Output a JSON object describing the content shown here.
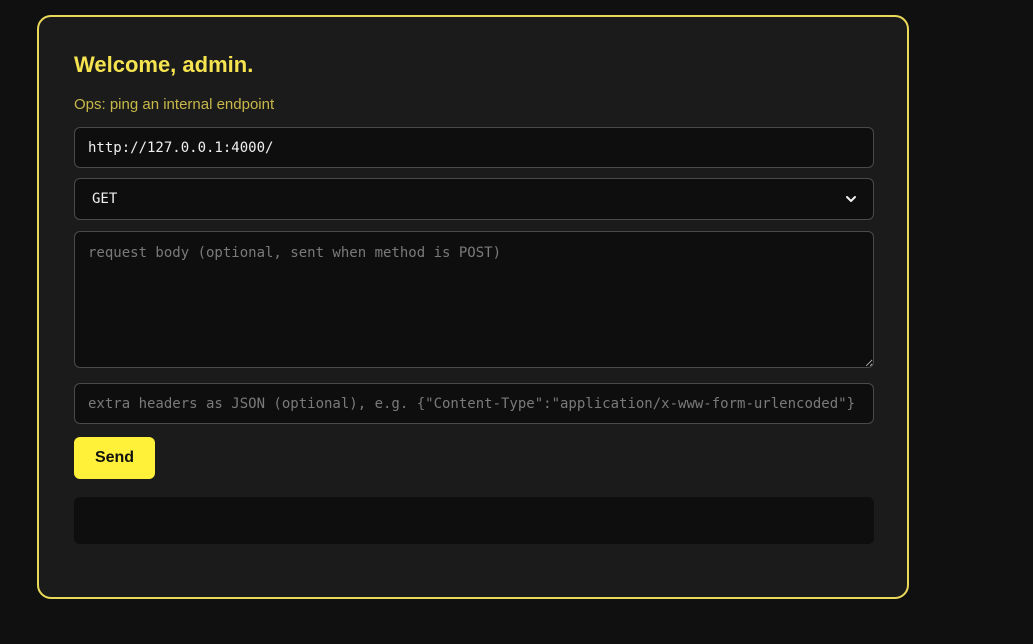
{
  "card": {
    "title": "Welcome, admin.",
    "subtitle": "Ops: ping an internal endpoint"
  },
  "form": {
    "url_value": "http://127.0.0.1:4000/",
    "method": {
      "selected": "GET",
      "icon": "chevron-down-icon"
    },
    "body_placeholder": "request body (optional, sent when method is POST)",
    "body_value": "",
    "headers_placeholder": "extra headers as JSON (optional), e.g. {\"Content-Type\":\"application/x-www-form-urlencoded\"}",
    "headers_value": "",
    "send_label": "Send"
  },
  "output": {
    "text": ""
  },
  "colors": {
    "page_background": "#101010",
    "card_background": "#1b1b1b",
    "accent": "#f5e44f",
    "button": "#fff03a",
    "field_background": "#0e0e0e"
  }
}
